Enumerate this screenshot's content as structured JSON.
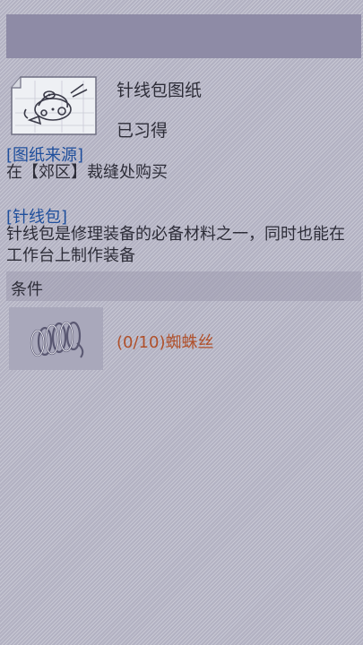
{
  "item": {
    "name": "针线包图纸",
    "status": "已习得",
    "icon": "sewing-kit-blueprint-icon"
  },
  "source": {
    "title": "[图纸来源]",
    "text": "在【郊区】裁缝处购买"
  },
  "description": {
    "title": "[针线包]",
    "text": "针线包是修理装备的必备材料之一，同时也能在工作台上制作装备"
  },
  "conditions": {
    "label": "条件",
    "requirements": [
      {
        "progress": "(0/10)",
        "material": "蜘蛛丝",
        "icon": "spider-silk-coil-icon"
      }
    ]
  },
  "colors": {
    "section_title": "#1f4f9c",
    "requirement_text": "#b0502a",
    "top_bar": "#8e8ba6"
  }
}
